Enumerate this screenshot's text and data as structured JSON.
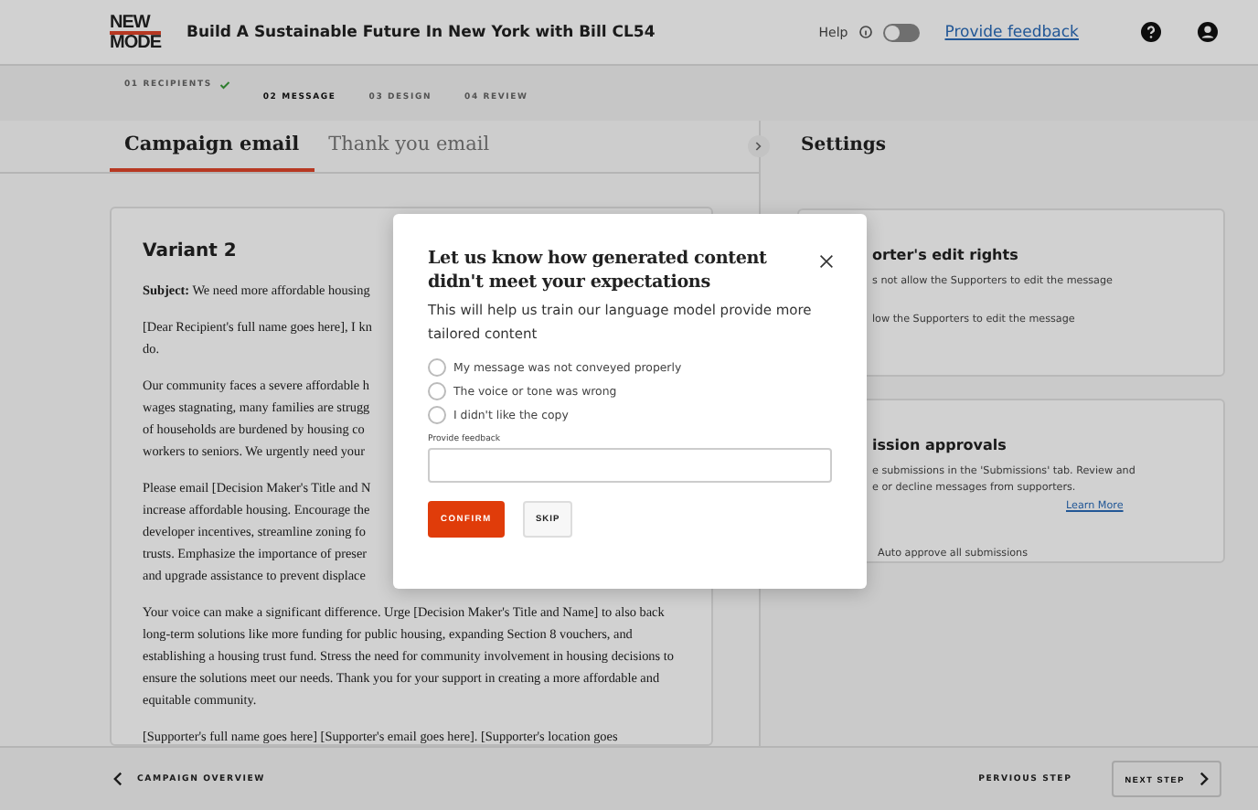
{
  "header": {
    "logo": [
      "NEW",
      "MODE"
    ],
    "title": "Build A Sustainable Future In New York with Bill CL54",
    "help_label": "Help",
    "help_toggle": {
      "on": false
    },
    "feedback_link": "Provide feedback"
  },
  "steps": [
    {
      "label": "01 RECIPIENTS",
      "done": true,
      "selected": false
    },
    {
      "label": "02 MESSAGE",
      "done": false,
      "selected": true
    },
    {
      "label": "03 DESIGN",
      "done": false,
      "selected": false
    },
    {
      "label": "04 REVIEW",
      "done": false,
      "selected": false
    }
  ],
  "tabs": [
    {
      "label": "Campaign email",
      "selected": true
    },
    {
      "label": "Thank you email",
      "selected": false
    }
  ],
  "settings_title": "Settings",
  "variant": {
    "title": "Variant 2",
    "paragraphs": [
      [
        "**Subject:** We need more affordable housing"
      ],
      [
        "[Dear Recipient's full name goes here], I kn",
        "do."
      ],
      [
        "Our community faces a severe affordable h",
        "wages stagnating, many families are strugg",
        "of households are burdened by housing co",
        "workers to seniors. We urgently need your"
      ],
      [
        "Please email [Decision Maker's Title and N",
        "increase affordable housing. Encourage the",
        "developer incentives, streamline zoning fo",
        "trusts. Emphasize the importance of preser",
        "and upgrade assistance to prevent displace"
      ]
    ],
    "full_paragraphs": [
      "Your voice can make a significant difference. Urge [Decision Maker's Title and Name] to also back long-term solutions like more funding for public housing, expanding Section 8 vouchers, and establishing a housing trust fund. Stress the need for community involvement in housing decisions to ensure the solutions meet our needs. Thank you for your support in creating a more affordable and equitable community.",
      "[Supporter's full name goes here] [Supporter's email goes here]. [Supporter's location goes"
    ]
  },
  "settings_cards": [
    {
      "title": "orter's edit rights",
      "lines": [
        "s not allow the Supporters to edit the message",
        "low the Supporters to edit the message"
      ]
    },
    {
      "title": "ission approvals",
      "lines": [
        "e submissions in the 'Submissions' tab. Review and",
        "e or decline messages from supporters."
      ],
      "link": "Learn More",
      "checkbox_label": "Auto approve all submissions"
    }
  ],
  "modal": {
    "title": "Let us know how generated content didn't meet your expectations",
    "subtitle": "This will help us train our language model provide more tailored content",
    "options": [
      {
        "label": "My message was not conveyed properly",
        "selected": false
      },
      {
        "label": "The voice or tone was wrong",
        "selected": false
      },
      {
        "label": "I didn't like the copy",
        "selected": false
      }
    ],
    "feedback_label": "Provide feedback",
    "confirm": "CONFIRM",
    "skip": "SKIP"
  },
  "footer": {
    "back": "CAMPAIGN OVERVIEW",
    "previous": "PERVIOUS STEP",
    "next": "NEXT STEP"
  }
}
